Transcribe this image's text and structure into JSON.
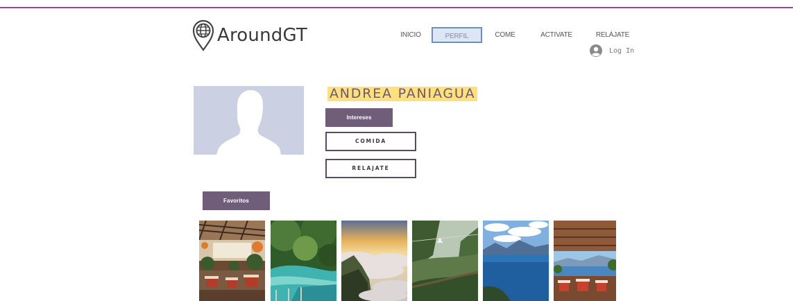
{
  "brand": {
    "name": "AroundGT"
  },
  "nav": {
    "items": [
      {
        "label": "INICIO"
      },
      {
        "label": "PERFIL"
      },
      {
        "label": "COME"
      },
      {
        "label": "ACTIVATE"
      },
      {
        "label": "RELÁJATE"
      }
    ],
    "active": "PERFIL",
    "login_label": "Log In"
  },
  "profile": {
    "name": "ANDREA PANIAGUA",
    "interests_label": "Intereses",
    "interest_buttons": [
      "COMIDA",
      "RELAJATE"
    ],
    "favorites_label": "Favoritos"
  },
  "gallery": {
    "images": [
      {
        "subject": "restaurant-patio"
      },
      {
        "subject": "turquoise-river-pools"
      },
      {
        "subject": "sunset-over-clouds"
      },
      {
        "subject": "zipline-over-valley"
      },
      {
        "subject": "lake-with-volcanoes"
      },
      {
        "subject": "lakeside-terrace"
      }
    ]
  },
  "colors": {
    "accent_purple": "#8e4a93",
    "button_purple": "#6f5d7a",
    "name_highlight": "#ffe07a",
    "avatar_placeholder": "#cbd0e3"
  }
}
